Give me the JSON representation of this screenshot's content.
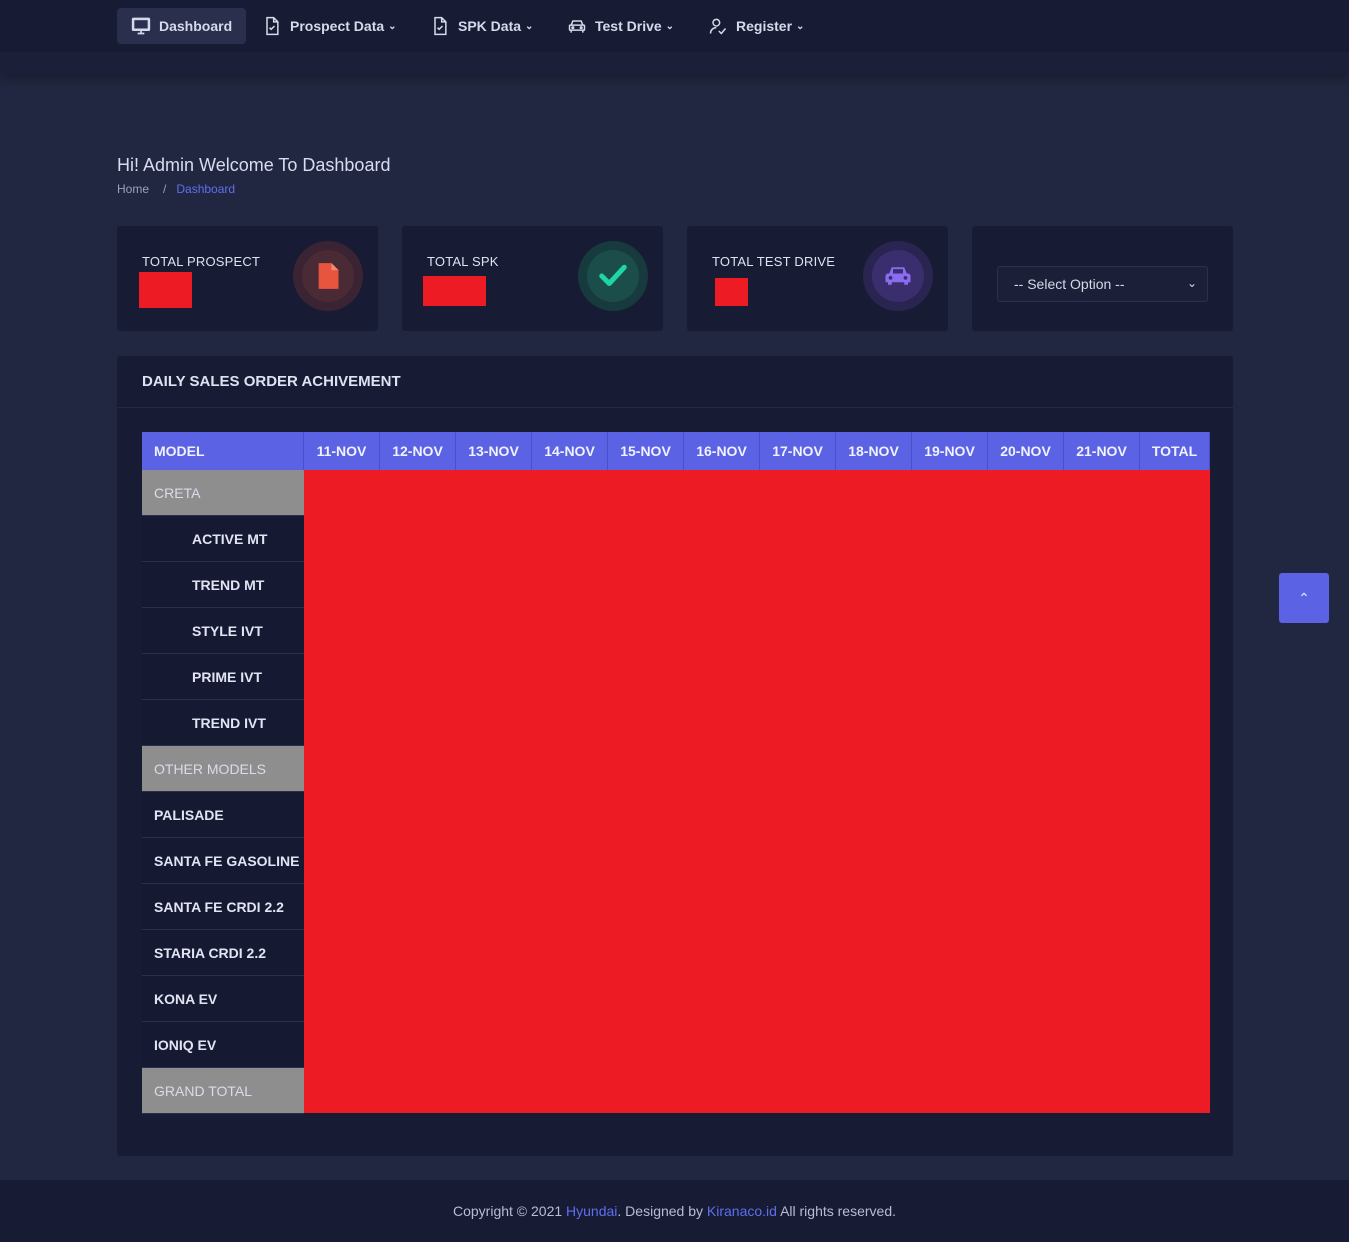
{
  "nav": {
    "items": [
      {
        "label": "Dashboard",
        "icon": "monitor-icon",
        "active": true
      },
      {
        "label": "Prospect Data",
        "icon": "document-check-icon"
      },
      {
        "label": "SPK Data",
        "icon": "document-check-icon"
      },
      {
        "label": "Test Drive",
        "icon": "car-icon"
      },
      {
        "label": "Register",
        "icon": "user-check-icon"
      }
    ]
  },
  "header": {
    "title": "Hi! Admin Welcome To Dashboard",
    "breadcrumb": {
      "home": "Home",
      "separator": "/",
      "current": "Dashboard"
    }
  },
  "cards": [
    {
      "label": "TOTAL PROSPECT",
      "icon": "file-icon",
      "accent": "#e8553f"
    },
    {
      "label": "TOTAL SPK",
      "icon": "check-icon",
      "accent": "#1ed6a4"
    },
    {
      "label": "TOTAL TEST DRIVE",
      "icon": "car-icon",
      "accent": "#8a6cf0"
    }
  ],
  "select": {
    "value": "-- Select Option --"
  },
  "table": {
    "title": "DAILY SALES ORDER ACHIVEMENT",
    "columns": [
      "MODEL",
      "11-NOV",
      "12-NOV",
      "13-NOV",
      "14-NOV",
      "15-NOV",
      "16-NOV",
      "17-NOV",
      "18-NOV",
      "19-NOV",
      "20-NOV",
      "21-NOV",
      "TOTAL"
    ],
    "rows": [
      {
        "label": "CRETA",
        "type": "group"
      },
      {
        "label": "ACTIVE MT",
        "type": "sub"
      },
      {
        "label": "TREND MT",
        "type": "sub"
      },
      {
        "label": "STYLE IVT",
        "type": "sub"
      },
      {
        "label": "PRIME IVT",
        "type": "sub"
      },
      {
        "label": "TREND IVT",
        "type": "sub"
      },
      {
        "label": "OTHER MODELS",
        "type": "group"
      },
      {
        "label": "PALISADE",
        "type": "item"
      },
      {
        "label": "SANTA FE GASOLINE",
        "type": "item"
      },
      {
        "label": "SANTA FE CRDI 2.2",
        "type": "item"
      },
      {
        "label": "STARIA CRDI 2.2",
        "type": "item"
      },
      {
        "label": "KONA EV",
        "type": "item"
      },
      {
        "label": "IONIQ EV",
        "type": "item"
      },
      {
        "label": "GRAND TOTAL",
        "type": "group"
      }
    ]
  },
  "footer": {
    "prefix": "Copyright © 2021 ",
    "brand": "Hyundai",
    "middle": ". Designed by ",
    "designer": "Kiranaco.id",
    "suffix": " All rights reserved."
  },
  "colors": {
    "accent": "#5b62e4",
    "redaction": "#ed1c24",
    "background": "#222741"
  }
}
